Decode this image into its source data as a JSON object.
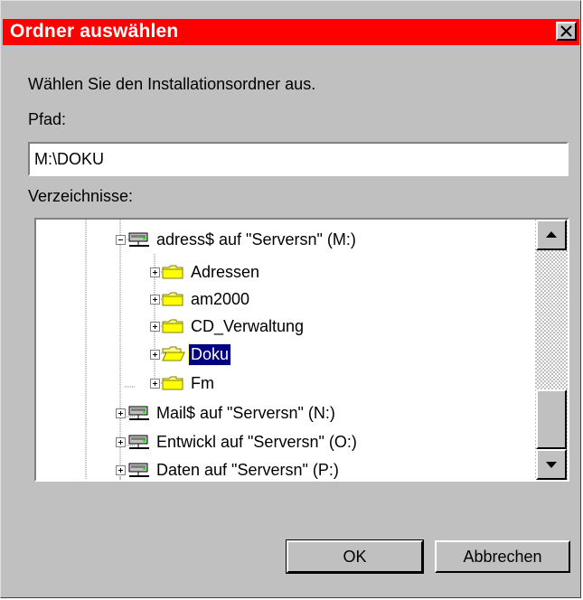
{
  "dialog": {
    "title": "Ordner auswählen",
    "instruction": "Wählen Sie den Installationsordner aus.",
    "path_label": "Pfad:",
    "path_value": "M:\\DOKU",
    "dirs_label": "Verzeichnisse:"
  },
  "tree": {
    "items": [
      {
        "label": "adress$ auf \"Serversn\" (M:)",
        "icon": "network-drive-icon",
        "expanded": true
      },
      {
        "label": "Adressen",
        "icon": "folder-icon"
      },
      {
        "label": "am2000",
        "icon": "folder-icon"
      },
      {
        "label": "CD_Verwaltung",
        "icon": "folder-icon"
      },
      {
        "label": "Doku",
        "icon": "open-folder-icon",
        "selected": true
      },
      {
        "label": "Fm",
        "icon": "folder-icon"
      },
      {
        "label": "Mail$ auf \"Serversn\" (N:)",
        "icon": "network-drive-icon"
      },
      {
        "label": "Entwickl auf \"Serversn\" (O:)",
        "icon": "network-drive-icon"
      },
      {
        "label": "Daten auf \"Serversn\" (P:)",
        "icon": "network-drive-icon"
      }
    ]
  },
  "buttons": {
    "ok": "OK",
    "cancel": "Abbrechen"
  },
  "colors": {
    "titlebar": "#ff0000",
    "selection": "#000080",
    "face": "#c0c0c0"
  }
}
